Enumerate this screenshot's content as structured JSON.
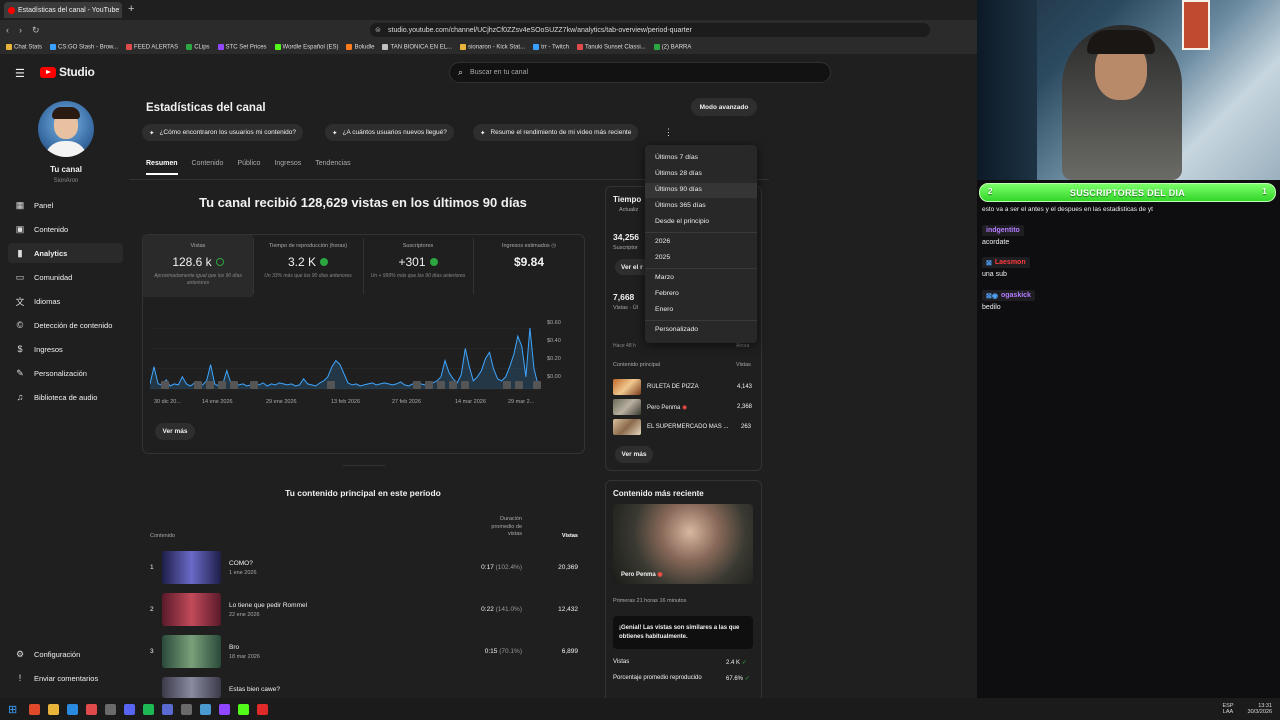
{
  "browser": {
    "tab_title": "Estadísticas del canal - YouTube",
    "url": "studio.youtube.com/channel/UCjhzCf0ZZsv4eSOoSUZZ7kw/analytics/tab-overview/period-quarter",
    "bookmarks": [
      "Chat Stats",
      "CS:GO Stash - Brow...",
      "FEED ALERTAS",
      "CLips",
      "STC Set Prices",
      "Wordle Español (ES)",
      "Boludle",
      "TAN BIONICA EN EL...",
      "sionaron - Kick Stat...",
      "trr - Twitch",
      "Tanuki Sunset Classi...",
      "(2) BARRA"
    ]
  },
  "studio": {
    "logo": "Studio",
    "search_placeholder": "Buscar en tu canal",
    "channel_name": "Tu canal",
    "channel_handle": "SionAron",
    "nav": [
      "Panel",
      "Contenido",
      "Analytics",
      "Comunidad",
      "Idiomas",
      "Detección de contenido",
      "Ingresos",
      "Personalización",
      "Biblioteca de audio"
    ],
    "nav_bottom": [
      "Configuración",
      "Enviar comentarios"
    ]
  },
  "page": {
    "title": "Estadísticas del canal",
    "advanced_mode": "Modo avanzado",
    "chips": [
      "¿Cómo encontraron los usuarios mi contenido?",
      "¿A cuántos usuarios nuevos llegué?",
      "Resume el rendimiento de mi video más reciente"
    ],
    "tabs": [
      "Resumen",
      "Contenido",
      "Público",
      "Ingresos",
      "Tendencias"
    ],
    "headline": "Tu canal recibió 128,629 vistas en los últimos 90 días",
    "stats": [
      {
        "label": "Vistas",
        "value": "128.6 k",
        "sub": "Aproximadamente igual que los 90 días anteriores"
      },
      {
        "label": "Tiempo de reproducción (horas)",
        "value": "3.2 K",
        "sub": "Un 33% más que los 90 días anteriores"
      },
      {
        "label": "Suscriptores",
        "value": "+301",
        "sub": "Un + 999% más que los 90 días anteriores"
      },
      {
        "label": "Ingresos estimados",
        "value": "$9.84",
        "sub": ""
      }
    ],
    "see_more": "Ver más"
  },
  "chart_data": {
    "type": "line",
    "x_ticks": [
      "30 dic 20...",
      "14 ene 2026",
      "29 ene 2026",
      "13 feb 2026",
      "27 feb 2026",
      "14 mar 2026",
      "29 mar 2..."
    ],
    "y_ticks": [
      "$0.60",
      "$0.40",
      "$0.20",
      "$0.00"
    ],
    "ylim": [
      0,
      0.65
    ],
    "values": [
      0.05,
      0.22,
      0.05,
      0.04,
      0.09,
      0.03,
      0.05,
      0.04,
      0.12,
      0.05,
      0.03,
      0.06,
      0.04,
      0.04,
      0.08,
      0.24,
      0.05,
      0.03,
      0.05,
      0.18,
      0.06,
      0.04,
      0.04,
      0.05,
      0.03,
      0.04,
      0.05,
      0.04,
      0.06,
      0.03,
      0.05,
      0.04,
      0.06,
      0.05,
      0.04,
      0.05,
      0.03,
      0.04,
      0.1,
      0.05,
      0.04,
      0.03,
      0.06,
      0.08,
      0.12,
      0.22,
      0.28,
      0.24,
      0.15,
      0.06,
      0.04,
      0.05,
      0.03,
      0.04,
      0.05,
      0.06,
      0.04,
      0.05,
      0.06,
      0.05,
      0.04,
      0.05,
      0.07,
      0.04,
      0.03,
      0.05,
      0.04,
      0.05,
      0.04,
      0.04,
      0.06,
      0.08,
      0.12,
      0.28,
      0.16,
      0.1,
      0.06,
      0.14,
      0.4,
      0.22,
      0.08,
      0.12,
      0.18,
      0.3,
      0.36,
      0.2,
      0.1,
      0.08,
      0.12,
      0.22,
      0.34,
      0.52,
      0.42,
      0.12,
      0.6,
      0.2,
      0.04
    ]
  },
  "realtime": {
    "title": "Tiempo",
    "updated": "Actualiz",
    "subs_value": "34,256",
    "subs_label": "Suscriptor",
    "see_btn": "Ver el r",
    "views_value": "7,668",
    "views_label": "Vistas · Úl",
    "ago_left": "Hace 48 h",
    "ago_right": "Ahora",
    "top_content_label": "Contenido principal",
    "views_col": "Vistas",
    "items": [
      {
        "title": "RULETA DE PIZZA",
        "views": "4,143"
      },
      {
        "title": "Pero Penma",
        "views": "2,368"
      },
      {
        "title": "EL SUPERMERCADO MAS ...",
        "views": "263"
      }
    ],
    "see_more": "Ver más"
  },
  "dropdown": {
    "items_top": [
      "Últimos 7 días",
      "Últimos 28 días",
      "Últimos 90 días",
      "Últimos 365 días",
      "Desde el principio"
    ],
    "years": [
      "2026",
      "2025"
    ],
    "months": [
      "Marzo",
      "Febrero",
      "Enero"
    ],
    "custom": "Personalizado"
  },
  "top_content": {
    "title": "Tu contenido principal en este período",
    "col_content": "Contenido",
    "col_duration": "Duración promedio de vistas",
    "col_views": "Vistas",
    "rows": [
      {
        "idx": "1",
        "title": "COMO?",
        "date": "1 ene 2026",
        "dur": "0:17",
        "pct": "(102.4%)",
        "views": "20,369"
      },
      {
        "idx": "2",
        "title": "Lo tiene que pedir Rommel",
        "date": "22 ene 2026",
        "dur": "0:22",
        "pct": "(141.0%)",
        "views": "12,432"
      },
      {
        "idx": "3",
        "title": "Bro",
        "date": "18 mar 2026",
        "dur": "0:15",
        "pct": "(70.1%)",
        "views": "6,899"
      },
      {
        "idx": "4",
        "title": "Estas bien cawe?",
        "date": "",
        "dur": "",
        "pct": "",
        "views": ""
      }
    ]
  },
  "latest": {
    "title": "Contenido más reciente",
    "video_title": "Pero Penma",
    "period": "Primeras 21 horas 16 minutos",
    "note": "¡Genial! Las vistas son similares a las que obtienes habitualmente.",
    "metrics": [
      {
        "label": "Vistas",
        "value": "2.4 K"
      },
      {
        "label": "Porcentaje promedio reproducido",
        "value": "67.6%"
      }
    ]
  },
  "stream": {
    "sub_banner": "SUSCRIPTORES DEL DIA",
    "sub_left": "2",
    "sub_right": "1",
    "first_line": "esto va a ser el antes y el despues en las estadisticas de yt",
    "messages": [
      {
        "user": "indgentito",
        "text": "acordate",
        "color": "#b57cff"
      },
      {
        "user": "Laesmon",
        "text": "una sub",
        "color": "#ff3b3b"
      },
      {
        "user": "ogaskick",
        "text": "bedilo",
        "color": "#b57cff"
      }
    ]
  },
  "taskbar": {
    "lang": "ESP",
    "lang2": "LAA",
    "time": "13:31",
    "date": "30/3/2026"
  }
}
